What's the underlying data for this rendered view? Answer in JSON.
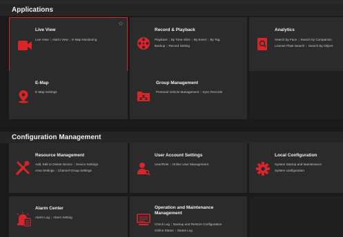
{
  "sections": {
    "applications": "Applications",
    "configuration": "Configuration Management"
  },
  "tiles": {
    "live_view": {
      "title": "Live View",
      "links": [
        "Live View",
        "Alarm View",
        "E-Map Monitoring"
      ]
    },
    "record_playback": {
      "title": "Record & Playback",
      "links_line1": [
        "Playback",
        "By Time Slice",
        "By Event",
        "By Tag"
      ],
      "links_line2": [
        "Backup",
        "Record Setting"
      ]
    },
    "analytics": {
      "title": "Analytics",
      "links_line1": [
        "Search by Face",
        "Search by Companion"
      ],
      "links_line2": [
        "License Plate Search",
        "Search By Object"
      ]
    },
    "emap": {
      "title": "E-Map",
      "links": [
        "E-Map Settings"
      ]
    },
    "group_management": {
      "title": "Group Management",
      "links": [
        "Personal Vehicle Management",
        "Sync Records"
      ]
    },
    "resource_management": {
      "title": "Resource Management",
      "links_line1": [
        "Add, Edit or Delete Device",
        "Device Settings"
      ],
      "links_line2": [
        "Area Settings",
        "Channel Group Settings"
      ]
    },
    "user_account": {
      "title": "User Account Settings",
      "links": [
        "User/Role",
        "Online User Management"
      ]
    },
    "local_config": {
      "title": "Local Configuration",
      "links_line1": [
        "System Startup and Maintenance"
      ],
      "links_line2": [
        "System configuration"
      ]
    },
    "alarm_center": {
      "title": "Alarm Center",
      "links": [
        "Alarm Log",
        "Alarm Setting"
      ]
    },
    "operation_maintenance": {
      "title_line1": "Operation and Maintenance",
      "title_line2": "Management",
      "links_line1": [
        "Check Log",
        "Backup and Restore Configuration"
      ],
      "links_line2": [
        "Online Status",
        "Status Log"
      ]
    }
  },
  "colors": {
    "accent": "#d9252a",
    "tile_bg": "#2b2b2b",
    "page_bg": "#1a1a1a",
    "favorite": "#d9a23a"
  },
  "icons": {
    "live_view": "video-camera-icon",
    "record_playback": "film-reel-icon",
    "analytics": "search-document-icon",
    "emap": "map-pin-icon",
    "group_management": "folder-group-icon",
    "resource_management": "tools-icon",
    "user_account": "user-search-icon",
    "local_config": "gear-icon",
    "alarm_center": "alarm-icon",
    "operation_maintenance": "monitor-log-icon",
    "favorite": "star-icon"
  }
}
